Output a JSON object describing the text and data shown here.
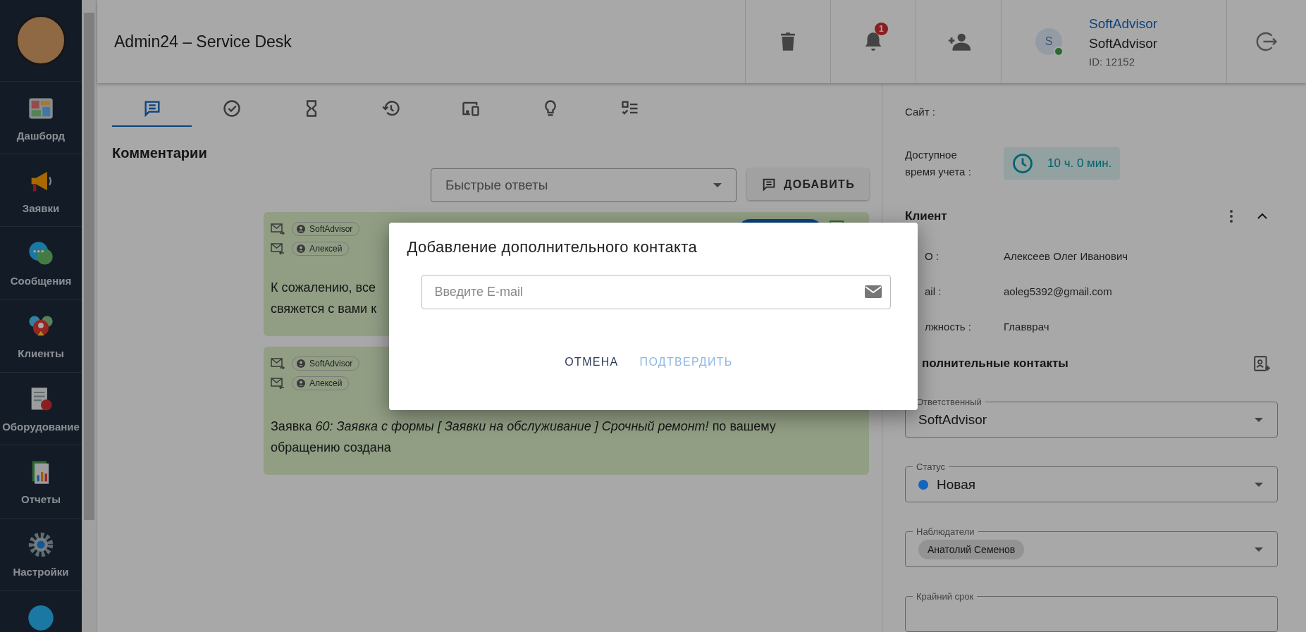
{
  "sidebar": {
    "items": [
      {
        "label": "Дашборд"
      },
      {
        "label": "Заявки"
      },
      {
        "label": "Сообщения"
      },
      {
        "label": "Клиенты"
      },
      {
        "label": "Оборудование"
      },
      {
        "label": "Отчеты"
      },
      {
        "label": "Настройки"
      }
    ]
  },
  "header": {
    "title": "Admin24 – Service Desk",
    "notifications_badge": "1",
    "user": {
      "link": "SoftAdvisor",
      "name": "SoftAdvisor",
      "id": "ID: 12152",
      "avatar_letter": "S",
      "online": true
    }
  },
  "tabs": [
    {
      "selected": true
    },
    {
      "selected": false
    },
    {
      "selected": false
    },
    {
      "selected": false
    },
    {
      "selected": false
    },
    {
      "selected": false
    },
    {
      "selected": false
    }
  ],
  "comments": {
    "title": "Комментарии",
    "quick_replies": {
      "placeholder": "Быстрые ответы"
    },
    "add_button": "ДОБАВИТЬ",
    "items": [
      {
        "from": "SoftAdvisor",
        "to": "Алексей",
        "lines": [
          "К сожалению, все",
          "свяжется с вами к"
        ]
      },
      {
        "from": "SoftAdvisor",
        "to": "Алексей",
        "lines": [
          "Заявка *60: Заявка с формы [ Заявки на обслуживание ] Срочный ремонт!* по вашему обращению создана"
        ]
      }
    ]
  },
  "details": {
    "site_label": "Сайт :",
    "time_label": "Доступное время учета :",
    "time_value": "10 ч. 0 мин.",
    "client": {
      "title": "Клиент",
      "expanded": true,
      "rows": [
        {
          "label": "О :",
          "value": "Алексеев Олег Иванович"
        },
        {
          "label": "ail :",
          "value": "aoleg5392@gmail.com"
        },
        {
          "label": "лжность :",
          "value": "Главврач"
        }
      ]
    },
    "extra_contacts_title": "полнительные контакты",
    "fields": [
      {
        "kind": "select",
        "label": "Ответственный",
        "value": "SoftAdvisor"
      },
      {
        "kind": "status",
        "label": "Статус",
        "value": "Новая",
        "color": "#1565c0"
      },
      {
        "kind": "chips",
        "label": "Наблюдатели",
        "chips": [
          "Анатолий Семенов"
        ]
      },
      {
        "kind": "date",
        "label": "Крайний срок"
      }
    ]
  },
  "dialog": {
    "title": "Добавление дополнительного контакта",
    "email": {
      "placeholder": "Введите E-mail"
    },
    "cancel": "ОТМЕНА",
    "confirm": {
      "label": "ПОДТВЕРДИТЬ",
      "disabled": true
    }
  }
}
